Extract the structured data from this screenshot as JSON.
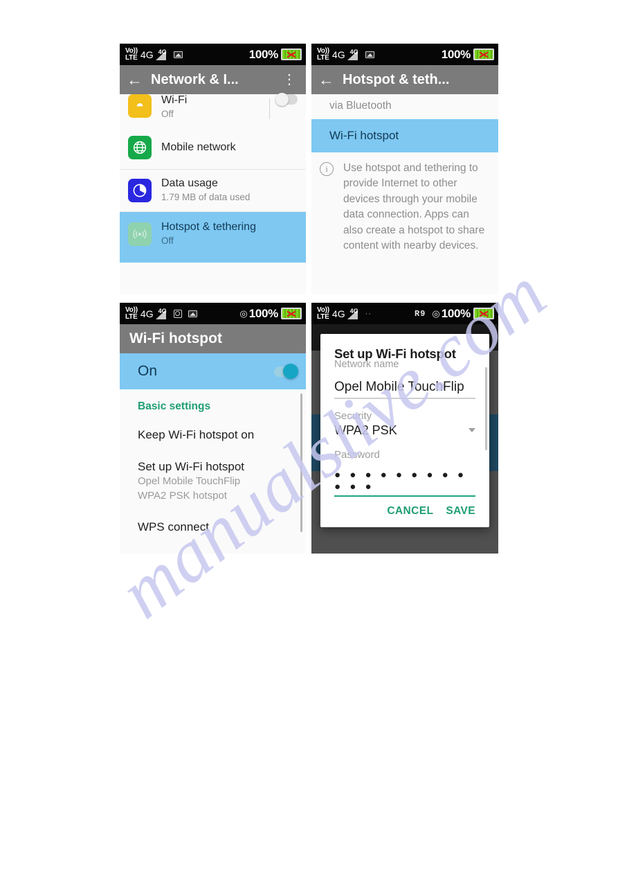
{
  "watermark": {
    "text": "manualslive.com"
  },
  "panel1": {
    "name": "network-and-internet-settings",
    "statusbar": {
      "volte_top": "Vo))",
      "volte_bottom": "LTE",
      "network": "4G",
      "signal_label": "4G",
      "icons": [
        "picture-icon"
      ],
      "battery_percent": "100%"
    },
    "appbar": {
      "back": "←",
      "title": "Network & I...",
      "menu": "⋮"
    },
    "rows": [
      {
        "label": "Wi-Fi",
        "sub": "Off",
        "icon": "wifi-icon",
        "toggle": "off",
        "selected": false
      },
      {
        "label": "Mobile network",
        "sub": "",
        "icon": "globe-icon",
        "selected": false
      },
      {
        "label": "Data usage",
        "sub": "1.79 MB of data used",
        "icon": "data-usage-icon",
        "selected": false
      },
      {
        "label": "Hotspot & tethering",
        "sub": "Off",
        "icon": "hotspot-icon",
        "selected": true
      }
    ]
  },
  "panel2": {
    "name": "hotspot-and-tethering-settings",
    "statusbar": {
      "volte_top": "Vo))",
      "volte_bottom": "LTE",
      "network": "4G",
      "signal_label": "4G",
      "battery_percent": "100%"
    },
    "appbar": {
      "back": "←",
      "title": "Hotspot & teth...",
      "menu": ""
    },
    "partial_row": "via Bluetooth",
    "selected_row": "Wi-Fi hotspot",
    "info": "Use hotspot and tethering to provide Internet to other devices through your mobile data connection. Apps can also create a hotspot to share content with nearby devices."
  },
  "panel3": {
    "name": "wifi-hotspot-settings",
    "statusbar": {
      "volte_top": "Vo))",
      "volte_bottom": "LTE",
      "network": "4G",
      "signal_label": "4G",
      "battery_percent": "100%"
    },
    "appbar": {
      "title": "Wi-Fi hotspot"
    },
    "toggle_row": {
      "label": "On",
      "state": "on"
    },
    "section_header": "Basic settings",
    "items": [
      {
        "title": "Keep Wi-Fi hotspot on",
        "sub1": "",
        "sub2": ""
      },
      {
        "title": "Set up Wi-Fi hotspot",
        "sub1": "Opel Mobile TouchFlip",
        "sub2": "WPA2 PSK hotspot"
      },
      {
        "title": "WPS connect",
        "sub1": "",
        "sub2": ""
      }
    ]
  },
  "panel4": {
    "name": "set-up-wifi-hotspot-dialog",
    "statusbar": {
      "volte_top": "Vo))",
      "volte_bottom": "LTE",
      "network": "4G",
      "signal_label": "4G",
      "rg_icon": "R9",
      "battery_percent": "100%"
    },
    "dialog": {
      "title": "Set up Wi-Fi hotspot",
      "network_name_label": "Network name",
      "network_name_value": "Opel Mobile TouchFlip",
      "security_label": "Security",
      "security_value": "WPA2 PSK",
      "password_label": "Password",
      "password_masked": "● ● ● ● ● ● ● ● ● ● ● ●",
      "cancel": "CANCEL",
      "save": "SAVE"
    }
  },
  "colors": {
    "selection_blue": "#7ec8f2",
    "accent_green": "#1f9e73",
    "appbar_gray": "#7b7b7b",
    "statusbar_black": "#060606",
    "wifi_icon": "#f2bf1b",
    "globe_icon": "#16a94a",
    "data_icon": "#2a27e0",
    "hotspot_icon": "#8fd2ae",
    "watermark": "#c7c8ef"
  }
}
